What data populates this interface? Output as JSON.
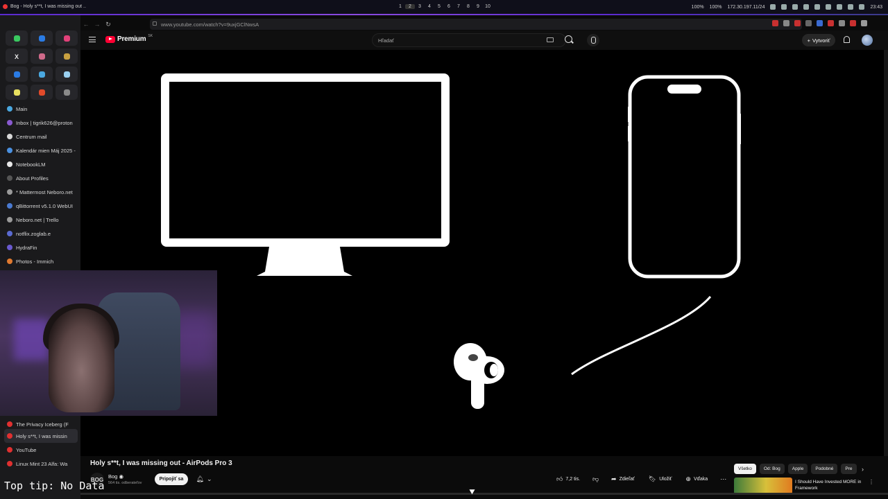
{
  "os_bar": {
    "window_title": "Bog - Holy s**t, I was missing out ..",
    "workspaces": [
      "1",
      "2",
      "3",
      "4",
      "5",
      "6",
      "7",
      "8",
      "9",
      "10"
    ],
    "active_workspace": "2",
    "status": [
      "100%",
      "100%",
      "172.30.197.11/24",
      "23:43"
    ]
  },
  "browser": {
    "url": "www.youtube.com/watch?v=9uxjGClNwsA"
  },
  "sidebar": {
    "pinned": [
      {
        "icon": "whatsapp-icon",
        "color": "#3ac960"
      },
      {
        "icon": "messenger-icon",
        "color": "#2a7be4"
      },
      {
        "icon": "instagram-icon",
        "color": "#e2417a"
      },
      {
        "icon": "x-icon",
        "color": "#e8e8e8",
        "glyph": "X"
      },
      {
        "icon": "app-grid-icon",
        "color": "#d06a8a"
      },
      {
        "icon": "app-grid-icon",
        "color": "#c8a040"
      },
      {
        "icon": "chat-icon",
        "color": "#2a7be4"
      },
      {
        "icon": "cloud-icon",
        "color": "#4aa8e0"
      },
      {
        "icon": "window-icon",
        "color": "#9ad0f0"
      },
      {
        "icon": "note-icon",
        "color": "#e8e060"
      },
      {
        "icon": "gitlab-icon",
        "color": "#e24a2a"
      },
      {
        "icon": "settings-icon",
        "color": "#8a8a8a"
      }
    ],
    "tabs": [
      {
        "label": "Main",
        "color": "#4aa8e0"
      },
      {
        "label": "Inbox | tigrik626@proton",
        "color": "#8a5ad0"
      },
      {
        "label": "Centrum mail",
        "color": "#d8d8d8"
      },
      {
        "label": "Kalendár mien Máj 2025 -",
        "color": "#4a90e0"
      },
      {
        "label": "NotebookLM",
        "color": "#e8e8e8"
      },
      {
        "label": "About Profiles",
        "color": "#555555"
      },
      {
        "label": "* Mattermost Neboro.net",
        "color": "#9a9a9a"
      },
      {
        "label": "qBittorrent v5.1.0 WebUI",
        "color": "#4a7ad0"
      },
      {
        "label": "Neboro.net | Trello",
        "color": "#9a9a9a"
      },
      {
        "label": "notflix.zoglab.e",
        "color": "#5a6ad0"
      },
      {
        "label": "HydraFin",
        "color": "#6a5ad0"
      },
      {
        "label": "Photos - Immich",
        "color": "#e07a30"
      }
    ],
    "tail_tabs": [
      {
        "label": "The Privacy Iceberg (F",
        "color": "#e03030",
        "active": false
      },
      {
        "label": "Holy s**t, I was missin",
        "color": "#e03030",
        "active": true
      },
      {
        "label": "YouTube",
        "color": "#e03030",
        "active": false
      },
      {
        "label": "Linux Mint 23 Alfa: Wa",
        "color": "#e03030",
        "active": false
      }
    ]
  },
  "youtube": {
    "logo_text": "Premium",
    "logo_superscript": "SK",
    "search_placeholder": "Hľadať",
    "create_label": "Vytvoriť",
    "video_title": "Holy s**t, I was missing out - AirPods Pro 3",
    "channel_initials": "BOG",
    "channel_name": "Bog",
    "channel_subs": "564 tis. odberateľov",
    "join_label": "Pripojiť sa",
    "actions": {
      "likes": "7,2 tis.",
      "share": "Zdieľať",
      "save": "Uložiť",
      "thanks": "Vďaka"
    },
    "chips": [
      "Všetko",
      "Od: Bog",
      "Apple",
      "Podobné",
      "Pre"
    ],
    "recommendation_title": "I Should Have Invested MORE in Framework"
  },
  "overlay_hint": "Top tip: No Data"
}
